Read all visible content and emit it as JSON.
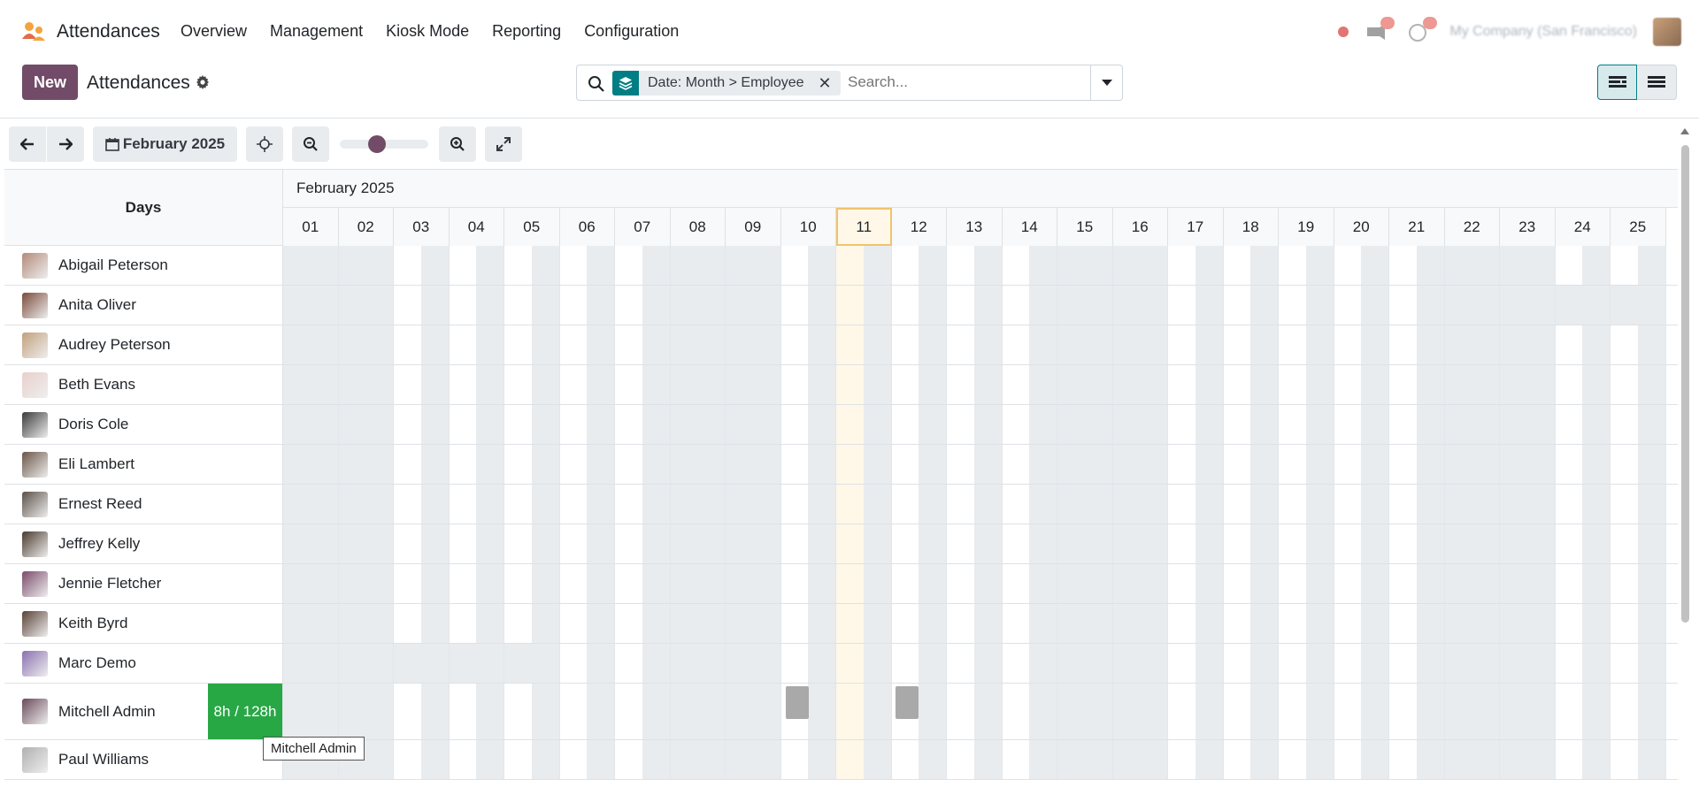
{
  "app": {
    "name": "Attendances",
    "menu": [
      "Overview",
      "Management",
      "Kiosk Mode",
      "Reporting",
      "Configuration"
    ],
    "company": "My Company (San Francisco)"
  },
  "control": {
    "new_label": "New",
    "title": "Attendances",
    "facet_label": "Date: Month > Employee",
    "search_placeholder": "Search..."
  },
  "gantt": {
    "period_label": "February 2025",
    "header_left": "Days",
    "month_label": "February 2025",
    "days": [
      "01",
      "02",
      "03",
      "04",
      "05",
      "06",
      "07",
      "08",
      "09",
      "10",
      "11",
      "12",
      "13",
      "14",
      "15",
      "16",
      "17",
      "18",
      "19",
      "20",
      "21",
      "22",
      "23",
      "24",
      "25"
    ],
    "today": "11",
    "employees": [
      {
        "name": "Abigail Peterson",
        "color": "#b48a7a"
      },
      {
        "name": "Anita Oliver",
        "color": "#7b4a3a"
      },
      {
        "name": "Audrey Peterson",
        "color": "#c2a07c"
      },
      {
        "name": "Beth Evans",
        "color": "#e8d0cc"
      },
      {
        "name": "Doris Cole",
        "color": "#3a3a3a"
      },
      {
        "name": "Eli Lambert",
        "color": "#6a5546"
      },
      {
        "name": "Ernest Reed",
        "color": "#5b5048"
      },
      {
        "name": "Jeffrey Kelly",
        "color": "#4a3a2e"
      },
      {
        "name": "Jennie Fletcher",
        "color": "#7a4a6a"
      },
      {
        "name": "Keith Byrd",
        "color": "#5a4236"
      },
      {
        "name": "Marc Demo",
        "color": "#8a70b0"
      },
      {
        "name": "Mitchell Admin",
        "color": "#6a4a5a",
        "total": "8h / 128h"
      },
      {
        "name": "Paul Williams",
        "color": "#b0b0b0"
      }
    ],
    "tooltip": "Mitchell Admin"
  },
  "colors": {
    "brand": "#714b67",
    "accent": "#017e84",
    "success": "#28a745",
    "today": "#fff8e8"
  }
}
